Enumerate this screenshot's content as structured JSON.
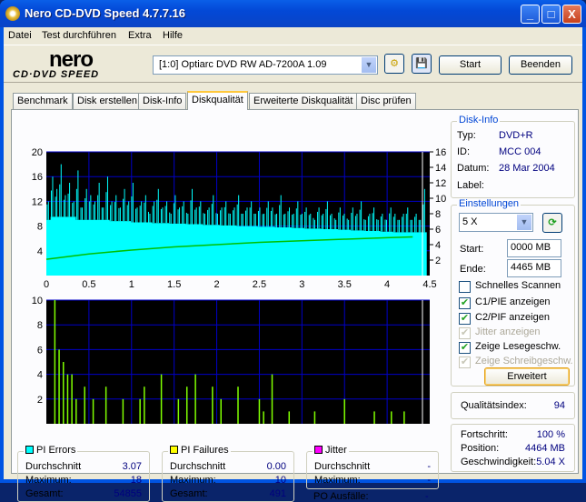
{
  "window": {
    "title": "Nero CD-DVD Speed 4.7.7.16",
    "minimize": "_",
    "maximize": "□",
    "close": "X"
  },
  "menu": [
    "Datei",
    "Test durchführen",
    "Extra",
    "Hilfe"
  ],
  "toolbar": {
    "logo_top": "nero",
    "logo_bottom": "CD·DVD SPEED",
    "drive": "[1:0]   Optiarc DVD RW AD-7200A 1.09",
    "start": "Start",
    "exit": "Beenden"
  },
  "tabs": [
    "Benchmark",
    "Disk erstellen",
    "Disk-Info",
    "Diskqualität",
    "Erweiterte Diskqualität",
    "Disc prüfen"
  ],
  "disk_info": {
    "title": "Disk-Info",
    "type_label": "Typ:",
    "type": "DVD+R",
    "id_label": "ID:",
    "id": "MCC 004",
    "date_label": "Datum:",
    "date": "28 Mar 2004",
    "label_label": "Label:"
  },
  "settings": {
    "title": "Einstellungen",
    "speed": "5 X",
    "start_label": "Start:",
    "start": "0000 MB",
    "end_label": "Ende:",
    "end": "4465 MB",
    "checks": [
      {
        "label": "Schnelles Scannen",
        "checked": false,
        "enabled": true
      },
      {
        "label": "C1/PIE anzeigen",
        "checked": true,
        "enabled": true
      },
      {
        "label": "C2/PIF anzeigen",
        "checked": true,
        "enabled": true
      },
      {
        "label": "Jitter anzeigen",
        "checked": true,
        "enabled": false
      },
      {
        "label": "Zeige Lesegeschw.",
        "checked": true,
        "enabled": true
      },
      {
        "label": "Zeige Schreibgeschw.",
        "checked": true,
        "enabled": false
      }
    ],
    "advanced": "Erweitert"
  },
  "quality": {
    "label": "Qualitätsindex:",
    "value": "94"
  },
  "progress": {
    "progress_label": "Fortschritt:",
    "progress": "100 %",
    "position_label": "Position:",
    "position": "4464 MB",
    "speed_label": "Geschwindigkeit:",
    "speed": "5.04 X"
  },
  "stats": {
    "pie": {
      "title": "PI Errors",
      "color": "#00ffff",
      "avg_label": "Durchschnitt",
      "avg": "3.07",
      "max_label": "Maximum:",
      "max": "18",
      "total_label": "Gesamt:",
      "total": "54855"
    },
    "pif": {
      "title": "PI Failures",
      "color": "#ffff00",
      "avg_label": "Durchschnitt",
      "avg": "0.00",
      "max_label": "Maximum:",
      "max": "10",
      "total_label": "Gesamt:",
      "total": "491"
    },
    "jitter": {
      "title": "Jitter",
      "color": "#ff00ff",
      "avg_label": "Durchschnitt",
      "avg": "-",
      "max_label": "Maximum:",
      "max": "-",
      "po_label": "PO Ausfälle:",
      "po": "-"
    }
  },
  "chart_data": [
    {
      "type": "area",
      "title": "PI Errors / Read speed",
      "xlim": [
        0,
        4.5
      ],
      "ylim": [
        0,
        20
      ],
      "y2lim": [
        0,
        16
      ],
      "xticks": [
        "0",
        "0.5",
        "1",
        "1.5",
        "2",
        "2.5",
        "3",
        "3.5",
        "4",
        "4.5"
      ],
      "yticks": [
        "4",
        "8",
        "12",
        "16",
        "20"
      ],
      "y2ticks": [
        "2",
        "4",
        "6",
        "8",
        "10",
        "12",
        "14",
        "16"
      ],
      "pie_max": [
        12,
        16,
        14,
        18,
        13,
        15,
        12,
        17,
        11,
        14,
        13,
        12,
        15,
        11,
        16,
        12,
        13,
        11,
        14,
        12,
        15,
        11,
        12,
        13,
        10,
        12,
        14,
        11,
        12,
        10,
        13,
        11,
        12,
        10,
        14,
        11,
        12,
        10,
        11,
        13,
        10,
        11,
        12,
        10,
        11,
        13,
        10,
        11,
        12,
        10,
        11,
        10,
        12,
        11,
        10,
        13,
        10,
        11,
        10,
        12,
        10,
        11,
        10,
        9,
        11,
        10,
        12,
        10,
        9,
        11,
        10,
        9,
        11,
        10,
        12,
        9,
        10,
        11,
        9,
        10,
        9,
        11,
        10,
        9,
        10,
        11,
        9,
        10,
        9,
        14
      ],
      "pie_base": [
        9,
        9.5,
        9.5,
        9.5,
        9.5,
        9.5,
        9.5,
        9,
        9,
        9,
        9,
        9,
        9,
        9,
        9,
        8.8,
        8.8,
        8.8,
        8.8,
        8.8,
        8.6,
        8.6,
        8.6,
        8.6,
        8.6,
        8.5,
        8.5,
        8.5,
        8.5,
        8.4,
        8.4,
        8.4,
        8.4,
        8.3,
        8.3,
        8.3,
        8.3,
        8.2,
        8.2,
        8.2,
        8.2,
        8.1,
        8.1,
        8.1,
        8.1,
        8,
        8,
        8,
        8,
        8,
        7.9,
        7.9,
        7.9,
        7.9,
        7.8,
        7.8,
        7.8,
        7.8,
        7.7,
        7.7,
        7.7,
        7.6,
        7.6,
        7.6,
        7.6,
        7.5,
        7.5,
        7.5,
        7.5,
        7.4,
        7.4,
        7.4,
        7.3,
        7.3,
        7.3,
        7.2,
        7.2,
        7.2,
        7.2,
        7.1,
        7.1,
        7.1,
        7,
        7,
        7,
        7,
        7,
        7,
        7,
        7
      ],
      "read_speed_x": [
        0,
        0.5,
        1,
        1.5,
        2,
        2.5,
        3,
        3.5,
        4,
        4.3
      ],
      "read_speed": [
        2.1,
        2.8,
        3.3,
        3.7,
        4.0,
        4.3,
        4.5,
        4.7,
        4.9,
        5.0
      ]
    },
    {
      "type": "bar",
      "title": "PI Failures",
      "xlim": [
        0,
        4.5
      ],
      "ylim": [
        0,
        10
      ],
      "xticks": [
        "0",
        "0.5",
        "1",
        "1.5",
        "2",
        "2.5",
        "3",
        "3.5",
        "4",
        "4.5"
      ],
      "yticks": [
        "2",
        "4",
        "6",
        "8",
        "10"
      ],
      "x": [
        0.1,
        0.15,
        0.2,
        0.25,
        0.3,
        0.35,
        0.45,
        0.55,
        0.7,
        0.9,
        1.1,
        1.15,
        1.35,
        1.55,
        1.65,
        1.75,
        1.95,
        2.05,
        2.25,
        2.5,
        2.55,
        2.65,
        2.85,
        3.15,
        3.5,
        3.85,
        4.05,
        4.2
      ],
      "values": [
        10,
        6,
        5,
        4,
        4,
        2,
        3,
        2,
        3,
        2,
        2,
        3,
        4,
        2,
        3,
        4,
        3,
        2,
        3,
        2,
        1,
        4,
        1,
        1,
        2,
        1,
        1,
        1
      ]
    }
  ]
}
